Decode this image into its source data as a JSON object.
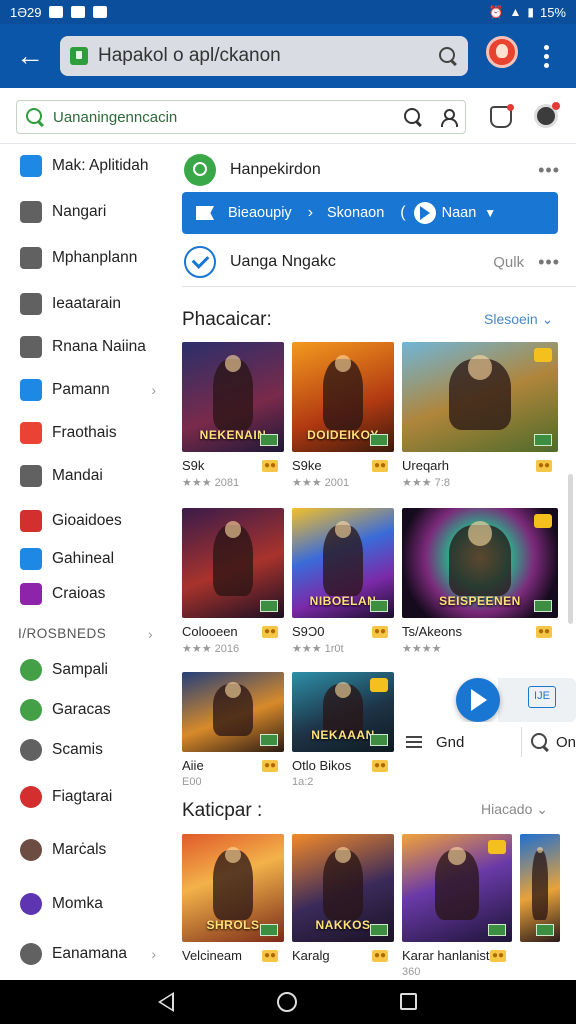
{
  "status_bar": {
    "time": "1Ə29",
    "battery": "15%"
  },
  "app_bar": {
    "url_text": "Hapakol o apl/ckanon",
    "colors": {
      "bar": "#0b56a8",
      "accent": "#1976d2",
      "green": "#2e9d3c"
    }
  },
  "subbar": {
    "search_text": "Uananingenncacin"
  },
  "sidebar": {
    "items": [
      {
        "label": "Mak: Aplitidah",
        "icon": "home-icon",
        "color": "#1e88e5"
      },
      {
        "label": "Nangari",
        "icon": "list-icon",
        "color": "#616161"
      },
      {
        "label": "Mphanplann",
        "icon": "bookmark-icon",
        "color": "#616161"
      },
      {
        "label": "Ieaatarain",
        "icon": "storefront-icon",
        "color": "#616161"
      },
      {
        "label": "Rnana Naiina",
        "icon": "pen-icon",
        "color": "#616161"
      },
      {
        "label": "Pamann",
        "icon": "tv-icon",
        "color": "#1e88e5",
        "chevron": true
      },
      {
        "label": "Fraothais",
        "icon": "play-store-icon",
        "color": "#ea4335"
      },
      {
        "label": "Mandai",
        "icon": "image-icon",
        "color": "#616161"
      },
      {
        "label": "Gioaidoes",
        "icon": "puzzle-icon",
        "color": "#d32f2f"
      },
      {
        "label": "Gahineal",
        "icon": "play-icon",
        "color": "#1e88e5"
      },
      {
        "label": "Craioas",
        "icon": "flower-icon",
        "color": "#8e24aa"
      }
    ],
    "section_label": "I/ROSBNEDS",
    "items2": [
      {
        "label": "Sampali",
        "icon": "check-icon",
        "color": "#43a047"
      },
      {
        "label": "Garacas",
        "icon": "circle-icon",
        "color": "#43a047"
      },
      {
        "label": "Scamis",
        "icon": "tag-icon",
        "color": "#616161"
      },
      {
        "label": "Fiagtarai",
        "icon": "chrome-icon",
        "color": "#d32f2f"
      },
      {
        "label": "Marċals",
        "icon": "face-icon",
        "color": "#6d4c41"
      },
      {
        "label": "Momka",
        "icon": "shield-icon",
        "color": "#5e35b1"
      },
      {
        "label": "Eanamana",
        "icon": "gear-icon",
        "color": "#616161",
        "chevron": true
      }
    ]
  },
  "main": {
    "row1_label": "Hanpekirdon",
    "bluebar": {
      "seg1": "Bieaoupiy",
      "seg2": "Skonaon",
      "seg3": "Naan"
    },
    "row3_label": "Uanga Nngakc",
    "row3_hint": "Qulk",
    "section1": {
      "title": "Phacaicar:",
      "link": "Slesoein"
    },
    "section2": {
      "title": "Katicpar :",
      "link": "Hiacado"
    },
    "filter": {
      "label": "Gnd",
      "other": "On"
    },
    "fab_panel": "IJE",
    "cards": [
      {
        "title": "S9k",
        "meta": "★★★ 2081",
        "banner": "NEKENAIN",
        "bg": "linear-gradient(160deg,#2a2f6b,#7a2a4a 60%,#1e1838)"
      },
      {
        "title": "S9ke",
        "meta": "★★★ 2001",
        "banner": "DOIDEIKOY",
        "bg": "linear-gradient(160deg,#f39a1e,#b33a12 60%,#3a1a0c)"
      },
      {
        "title": "Ureqarh",
        "meta": "★★★ 7:8",
        "banner": "",
        "bg": "linear-gradient(160deg,#6fb6d8,#b0853b 50%,#4e6b2a)"
      },
      {
        "title": "Colooeen",
        "meta": "★★★ 2016",
        "banner": "",
        "bg": "linear-gradient(160deg,#3a1b4a,#a8332c 55%,#1b1024)"
      },
      {
        "title": "S9Ͻ0",
        "meta": "★★★ 1r0t",
        "banner": "NIBOELAN",
        "bg": "linear-gradient(160deg,#f4c02a,#3a6bd8 40%,#7b2aa8 70%,#1a0e2a)"
      },
      {
        "title": "Ts/Akeons",
        "meta": "★★★★",
        "banner": "SEISPEENEN",
        "bg": "radial-gradient(circle at 50% 45%,#f7e07a,#2bb08a 30%,#7b2a7a 55%,#160b1e 80%)"
      },
      {
        "title": "Aiie",
        "meta": "E00",
        "banner": "",
        "bg": "linear-gradient(160deg,#243f7a,#d88a2a 55%,#2a1a14)"
      },
      {
        "title": "Otlo Bikos",
        "meta": "1a:2",
        "banner": "NEKAAAN",
        "bg": "linear-gradient(160deg,#2d8fa8,#1e3448 55%,#0e1a20)"
      },
      {
        "title": "Velcineam",
        "meta": "",
        "banner": "SHROLS",
        "bg": "linear-gradient(160deg,#e05a2a,#f3b24a 40%,#7a2a18)"
      },
      {
        "title": "Karalg",
        "meta": "",
        "banner": "NAKKOS",
        "bg": "linear-gradient(160deg,#f28a2a,#3a2a5a 55%,#1a1224)"
      },
      {
        "title": "Karar hanlaniste",
        "meta": "360",
        "banner": "",
        "bg": "linear-gradient(160deg,#f2a23a,#6a3aa8 45%,#1e1438)"
      },
      {
        "title": "",
        "meta": "",
        "banner": "",
        "bg": "linear-gradient(160deg,#1f6fd0,#e8a23a 55%,#2a1a1a)"
      }
    ]
  }
}
